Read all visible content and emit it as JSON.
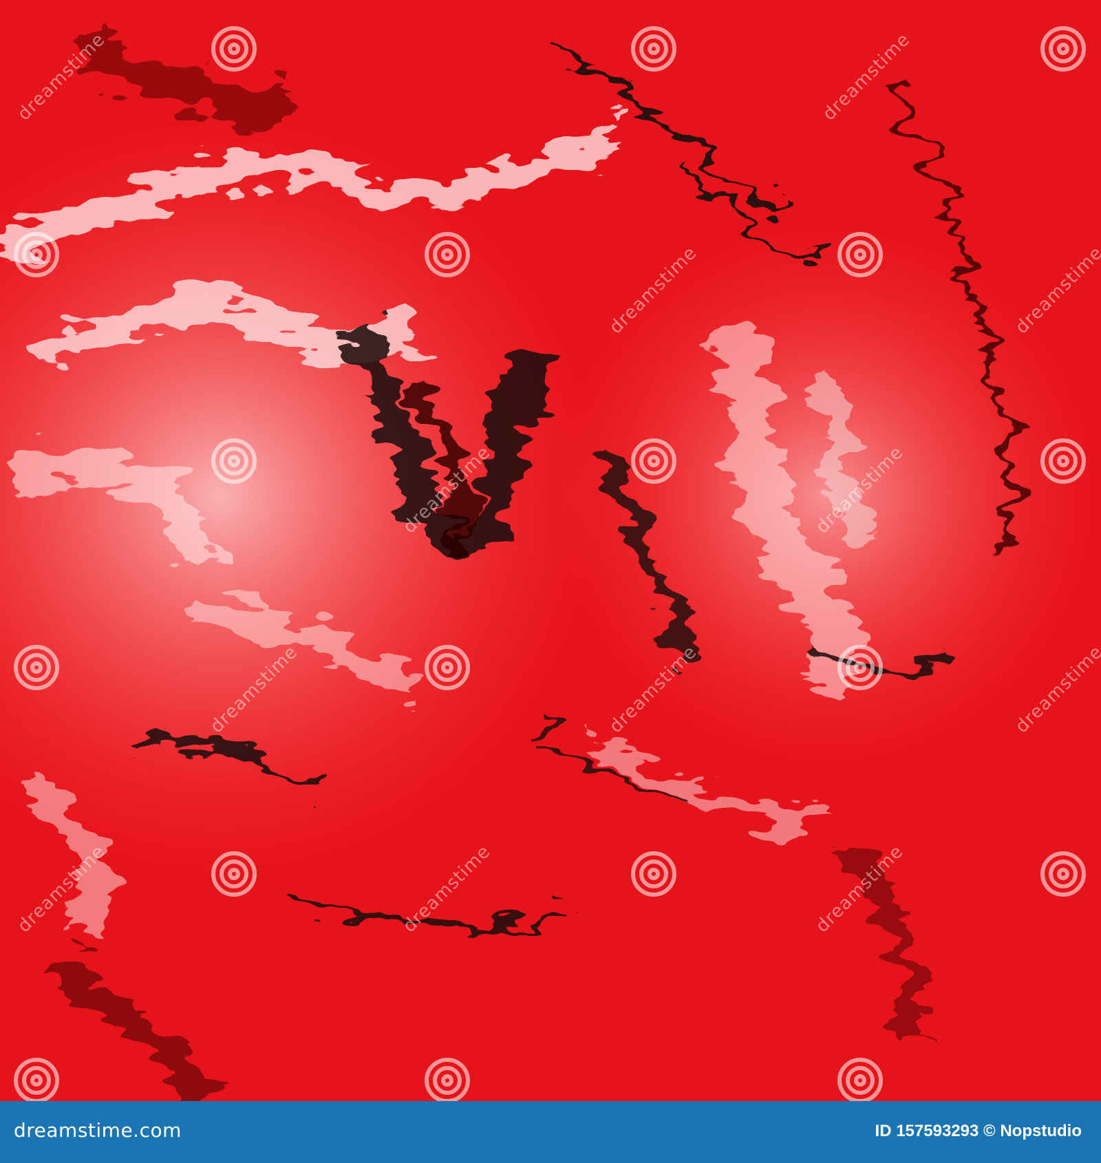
{
  "image": {
    "description_colors": {
      "base": "#e6141a",
      "dark": "#1a0a0a",
      "light": "#f4e6e6",
      "footer": "#1b75b3"
    }
  },
  "watermark": {
    "word": "dreamstime",
    "icon": "spiral-icon"
  },
  "footer": {
    "logo_text": "dreamstime.com",
    "id_text": "ID 157593293 © Nopstudio"
  }
}
